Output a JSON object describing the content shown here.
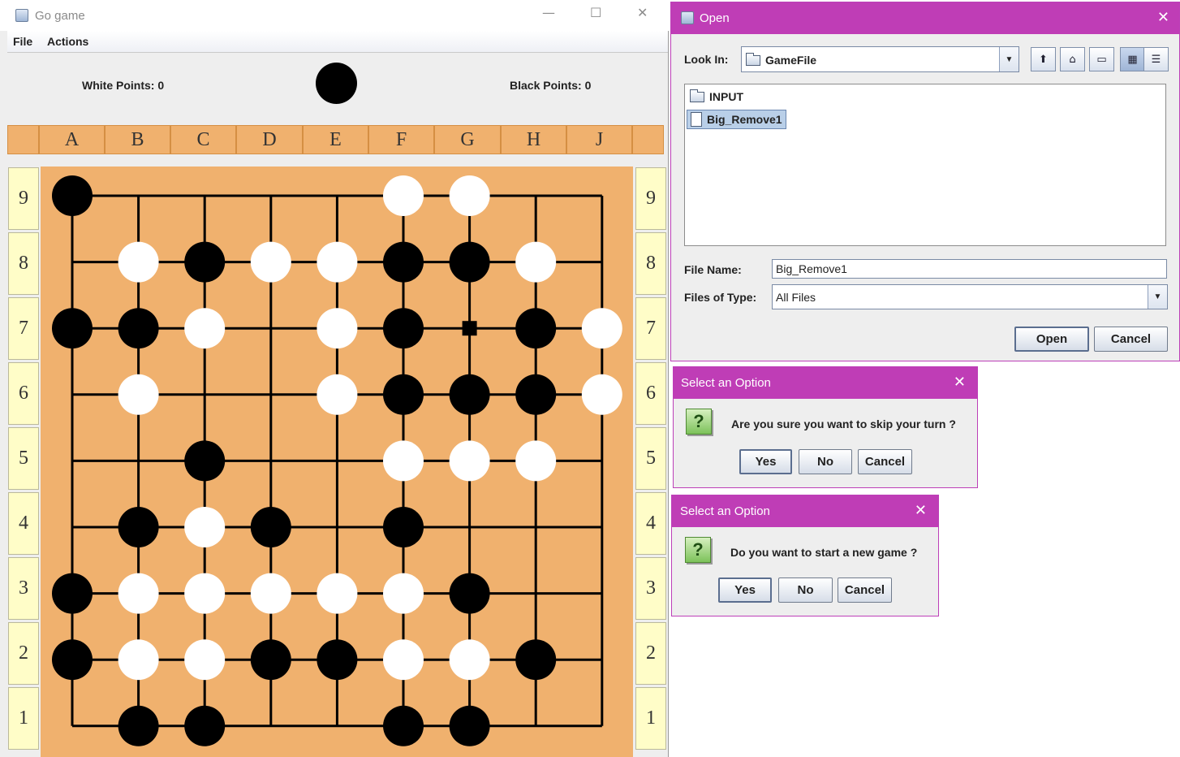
{
  "go_window": {
    "title": "Go game",
    "controls": {
      "minimize": "—",
      "maximize": "☐",
      "close": "✕"
    },
    "menu": [
      "File",
      "Actions"
    ],
    "white_points": "White Points: 0",
    "black_points": "Black Points: 0",
    "current_turn": "black",
    "columns": [
      "A",
      "B",
      "C",
      "D",
      "E",
      "F",
      "G",
      "H",
      "J"
    ],
    "rows": [
      "9",
      "8",
      "7",
      "6",
      "5",
      "4",
      "3",
      "2",
      "1"
    ],
    "board": {
      "size": 9,
      "colors": {
        "board": "#f0b16e",
        "black": "#000000",
        "white": "#ffffff"
      },
      "stones": [
        {
          "col": "A",
          "row": 9,
          "color": "black"
        },
        {
          "col": "F",
          "row": 9,
          "color": "white"
        },
        {
          "col": "G",
          "row": 9,
          "color": "white"
        },
        {
          "col": "B",
          "row": 8,
          "color": "white"
        },
        {
          "col": "C",
          "row": 8,
          "color": "black"
        },
        {
          "col": "D",
          "row": 8,
          "color": "white"
        },
        {
          "col": "E",
          "row": 8,
          "color": "white"
        },
        {
          "col": "F",
          "row": 8,
          "color": "black"
        },
        {
          "col": "G",
          "row": 8,
          "color": "black"
        },
        {
          "col": "H",
          "row": 8,
          "color": "white"
        },
        {
          "col": "A",
          "row": 7,
          "color": "black"
        },
        {
          "col": "B",
          "row": 7,
          "color": "black"
        },
        {
          "col": "C",
          "row": 7,
          "color": "white"
        },
        {
          "col": "E",
          "row": 7,
          "color": "white"
        },
        {
          "col": "F",
          "row": 7,
          "color": "black"
        },
        {
          "col": "H",
          "row": 7,
          "color": "black"
        },
        {
          "col": "J",
          "row": 7,
          "color": "white"
        },
        {
          "col": "B",
          "row": 6,
          "color": "white"
        },
        {
          "col": "E",
          "row": 6,
          "color": "white"
        },
        {
          "col": "F",
          "row": 6,
          "color": "black"
        },
        {
          "col": "G",
          "row": 6,
          "color": "black"
        },
        {
          "col": "H",
          "row": 6,
          "color": "black"
        },
        {
          "col": "J",
          "row": 6,
          "color": "white"
        },
        {
          "col": "C",
          "row": 5,
          "color": "black"
        },
        {
          "col": "F",
          "row": 5,
          "color": "white"
        },
        {
          "col": "G",
          "row": 5,
          "color": "white"
        },
        {
          "col": "H",
          "row": 5,
          "color": "white"
        },
        {
          "col": "B",
          "row": 4,
          "color": "black"
        },
        {
          "col": "C",
          "row": 4,
          "color": "white"
        },
        {
          "col": "D",
          "row": 4,
          "color": "black"
        },
        {
          "col": "F",
          "row": 4,
          "color": "black"
        },
        {
          "col": "A",
          "row": 3,
          "color": "black"
        },
        {
          "col": "B",
          "row": 3,
          "color": "white"
        },
        {
          "col": "C",
          "row": 3,
          "color": "white"
        },
        {
          "col": "D",
          "row": 3,
          "color": "white"
        },
        {
          "col": "E",
          "row": 3,
          "color": "white"
        },
        {
          "col": "F",
          "row": 3,
          "color": "white"
        },
        {
          "col": "G",
          "row": 3,
          "color": "black"
        },
        {
          "col": "A",
          "row": 2,
          "color": "black"
        },
        {
          "col": "B",
          "row": 2,
          "color": "white"
        },
        {
          "col": "C",
          "row": 2,
          "color": "white"
        },
        {
          "col": "D",
          "row": 2,
          "color": "black"
        },
        {
          "col": "E",
          "row": 2,
          "color": "black"
        },
        {
          "col": "F",
          "row": 2,
          "color": "white"
        },
        {
          "col": "G",
          "row": 2,
          "color": "white"
        },
        {
          "col": "H",
          "row": 2,
          "color": "black"
        },
        {
          "col": "B",
          "row": 1,
          "color": "black"
        },
        {
          "col": "C",
          "row": 1,
          "color": "black"
        },
        {
          "col": "F",
          "row": 1,
          "color": "black"
        },
        {
          "col": "G",
          "row": 1,
          "color": "black"
        }
      ],
      "markers": [
        {
          "col": "G",
          "row": 7,
          "shape": "square"
        }
      ]
    }
  },
  "open_dialog": {
    "title": "Open",
    "close": "✕",
    "look_in_label": "Look In:",
    "look_in_value": "GameFile",
    "toolbar_icons": [
      "up-folder-icon",
      "home-icon",
      "new-folder-icon",
      "list-view-icon",
      "details-view-icon"
    ],
    "files": [
      {
        "name": "INPUT",
        "type": "folder",
        "selected": false
      },
      {
        "name": "Big_Remove1",
        "type": "file",
        "selected": true
      }
    ],
    "file_name_label": "File Name:",
    "file_name_value": "Big_Remove1",
    "files_of_type_label": "Files of Type:",
    "files_of_type_value": "All Files",
    "open_button": "Open",
    "cancel_button": "Cancel"
  },
  "skip_dialog": {
    "title": "Select an Option",
    "close": "✕",
    "message": "Are you sure you want to skip your turn ?",
    "yes": "Yes",
    "no": "No",
    "cancel": "Cancel"
  },
  "newgame_dialog": {
    "title": "Select an Option",
    "close": "✕",
    "message": "Do you want to start a new game ?",
    "yes": "Yes",
    "no": "No",
    "cancel": "Cancel"
  },
  "colors": {
    "dialog_title": "#bf3db6",
    "board": "#f0b16e",
    "row_header": "#fffdc8"
  }
}
